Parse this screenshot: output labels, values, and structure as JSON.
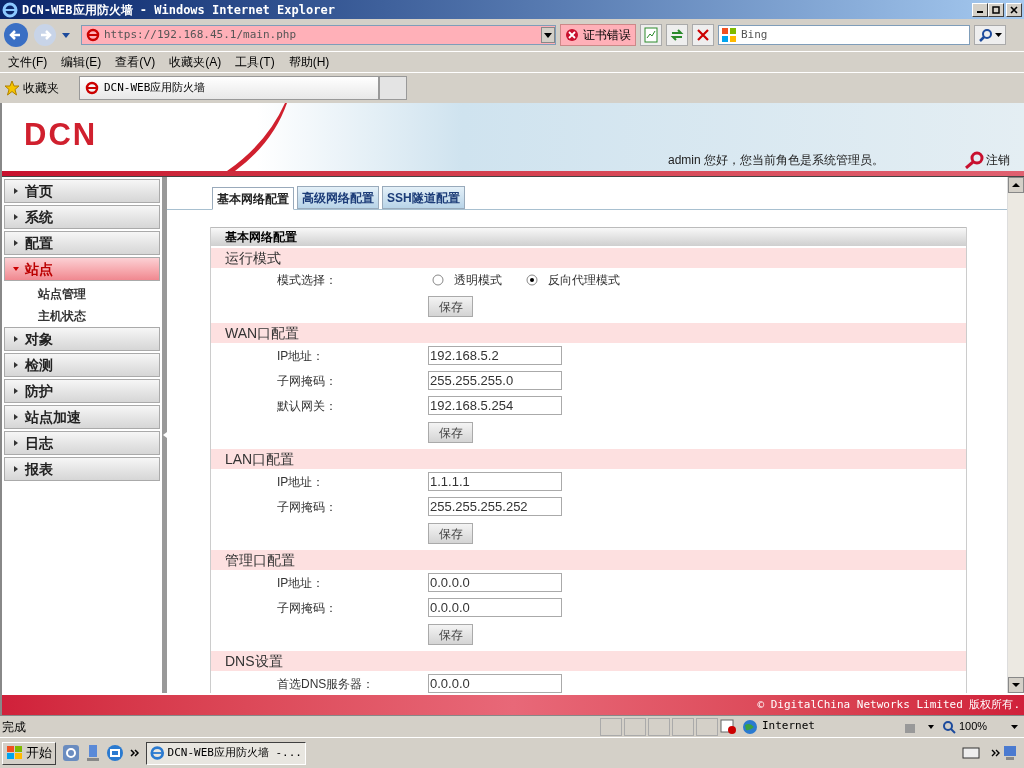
{
  "browser": {
    "title": "DCN-WEB应用防火墙 - Windows Internet Explorer",
    "address": "https://192.168.45.1/main.php",
    "cert_error": "证书错误",
    "search_placeholder": "Bing",
    "menu": [
      "文件(F)",
      "编辑(E)",
      "查看(V)",
      "收藏夹(A)",
      "工具(T)",
      "帮助(H)"
    ],
    "favorites": "收藏夹",
    "tab_title": "DCN-WEB应用防火墙"
  },
  "header": {
    "logo": "DCN",
    "user_text": "admin 您好，您当前角色是系统管理员。",
    "logout": "注销"
  },
  "sidebar": {
    "items": [
      {
        "label": "首页",
        "expanded": false,
        "selected": false
      },
      {
        "label": "系统",
        "expanded": false,
        "selected": false
      },
      {
        "label": "配置",
        "expanded": false,
        "selected": false
      },
      {
        "label": "站点",
        "expanded": true,
        "selected": true,
        "children": [
          {
            "label": "站点管理"
          },
          {
            "label": "主机状态"
          }
        ]
      },
      {
        "label": "对象",
        "expanded": false,
        "selected": false
      },
      {
        "label": "检测",
        "expanded": false,
        "selected": false
      },
      {
        "label": "防护",
        "expanded": false,
        "selected": false
      },
      {
        "label": "站点加速",
        "expanded": false,
        "selected": false
      },
      {
        "label": "日志",
        "expanded": false,
        "selected": false
      },
      {
        "label": "报表",
        "expanded": false,
        "selected": false
      }
    ]
  },
  "tabs": [
    {
      "label": "基本网络配置",
      "selected": true
    },
    {
      "label": "高级网络配置",
      "selected": false
    },
    {
      "label": "SSH隧道配置",
      "selected": false
    }
  ],
  "panel": {
    "title": "基本网络配置",
    "sections": [
      {
        "title": "运行模式",
        "rows": [
          {
            "kind": "radio",
            "label": "模式选择：",
            "options": [
              {
                "label": "透明模式",
                "selected": false
              },
              {
                "label": "反向代理模式",
                "selected": true
              }
            ]
          }
        ],
        "button": "保存"
      },
      {
        "title": "WAN口配置",
        "rows": [
          {
            "kind": "input",
            "label": "IP地址：",
            "value": "192.168.5.2"
          },
          {
            "kind": "input",
            "label": "子网掩码：",
            "value": "255.255.255.0"
          },
          {
            "kind": "input",
            "label": "默认网关：",
            "value": "192.168.5.254"
          }
        ],
        "button": "保存"
      },
      {
        "title": "LAN口配置",
        "rows": [
          {
            "kind": "input",
            "label": "IP地址：",
            "value": "1.1.1.1"
          },
          {
            "kind": "input",
            "label": "子网掩码：",
            "value": "255.255.255.252"
          }
        ],
        "button": "保存"
      },
      {
        "title": "管理口配置",
        "rows": [
          {
            "kind": "input",
            "label": "IP地址：",
            "value": "0.0.0.0"
          },
          {
            "kind": "input",
            "label": "子网掩码：",
            "value": "0.0.0.0"
          }
        ],
        "button": "保存"
      },
      {
        "title": "DNS设置",
        "rows": [
          {
            "kind": "input",
            "label": "首选DNS服务器：",
            "value": "0.0.0.0"
          }
        ]
      }
    ]
  },
  "footer": "© DigitalChina Networks Limited 版权所有.",
  "status_bar": {
    "text": "完成",
    "zone": "Internet",
    "zoom": "100%"
  },
  "taskbar": {
    "start": "开始",
    "window": "DCN-WEB应用防火墙 -..."
  }
}
